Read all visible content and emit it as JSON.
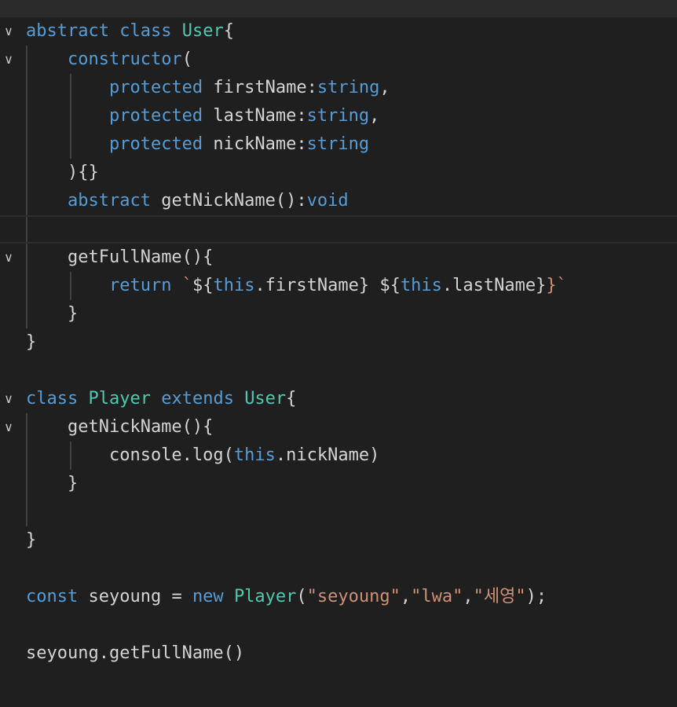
{
  "lines": [
    {
      "fold": true,
      "tokens": [
        [
          "kw",
          "abstract"
        ],
        [
          "pl",
          " "
        ],
        [
          "kw",
          "class"
        ],
        [
          "pl",
          " "
        ],
        [
          "ty",
          "User"
        ],
        [
          "pl",
          "{"
        ]
      ]
    },
    {
      "fold": true,
      "tokens": [
        [
          "pl",
          "    "
        ],
        [
          "kw",
          "constructor"
        ],
        [
          "pl",
          "("
        ]
      ]
    },
    {
      "fold": false,
      "tokens": [
        [
          "pl",
          "        "
        ],
        [
          "kw",
          "protected"
        ],
        [
          "pl",
          " firstName:"
        ],
        [
          "kw",
          "string"
        ],
        [
          "pl",
          ","
        ]
      ]
    },
    {
      "fold": false,
      "tokens": [
        [
          "pl",
          "        "
        ],
        [
          "kw",
          "protected"
        ],
        [
          "pl",
          " lastName:"
        ],
        [
          "kw",
          "string"
        ],
        [
          "pl",
          ","
        ]
      ]
    },
    {
      "fold": false,
      "tokens": [
        [
          "pl",
          "        "
        ],
        [
          "kw",
          "protected"
        ],
        [
          "pl",
          " nickName:"
        ],
        [
          "kw",
          "string"
        ]
      ]
    },
    {
      "fold": false,
      "tokens": [
        [
          "pl",
          "    "
        ],
        [
          "pl",
          "){}"
        ]
      ]
    },
    {
      "fold": false,
      "tokens": [
        [
          "pl",
          "    "
        ],
        [
          "kw",
          "abstract"
        ],
        [
          "pl",
          " getNickName():"
        ],
        [
          "kw",
          "void"
        ]
      ]
    },
    {
      "fold": false,
      "current": true,
      "tokens": []
    },
    {
      "fold": true,
      "tokens": [
        [
          "pl",
          "    "
        ],
        [
          "pl",
          "getFullName(){"
        ]
      ]
    },
    {
      "fold": false,
      "tokens": [
        [
          "pl",
          "        "
        ],
        [
          "kw",
          "return"
        ],
        [
          "pl",
          " "
        ],
        [
          "st",
          "`"
        ],
        [
          "pl",
          "${"
        ],
        [
          "kw",
          "this"
        ],
        [
          "pl",
          ".firstName} ${"
        ],
        [
          "kw",
          "this"
        ],
        [
          "pl",
          ".lastName}"
        ],
        [
          "st",
          "}`"
        ]
      ]
    },
    {
      "fold": false,
      "tokens": [
        [
          "pl",
          "    }"
        ]
      ]
    },
    {
      "fold": false,
      "tokens": [
        [
          "pl",
          "}"
        ]
      ]
    },
    {
      "fold": false,
      "tokens": []
    },
    {
      "fold": true,
      "tokens": [
        [
          "kw",
          "class"
        ],
        [
          "pl",
          " "
        ],
        [
          "ty",
          "Player"
        ],
        [
          "pl",
          " "
        ],
        [
          "kw",
          "extends"
        ],
        [
          "pl",
          " "
        ],
        [
          "ty",
          "User"
        ],
        [
          "pl",
          "{"
        ]
      ]
    },
    {
      "fold": true,
      "tokens": [
        [
          "pl",
          "    getNickName(){"
        ]
      ]
    },
    {
      "fold": false,
      "tokens": [
        [
          "pl",
          "        console.log("
        ],
        [
          "kw",
          "this"
        ],
        [
          "pl",
          ".nickName)"
        ]
      ]
    },
    {
      "fold": false,
      "tokens": [
        [
          "pl",
          "    }"
        ]
      ]
    },
    {
      "fold": false,
      "tokens": []
    },
    {
      "fold": false,
      "tokens": [
        [
          "pl",
          "}"
        ]
      ]
    },
    {
      "fold": false,
      "tokens": []
    },
    {
      "fold": false,
      "tokens": [
        [
          "kw",
          "const"
        ],
        [
          "pl",
          " seyoung = "
        ],
        [
          "kw",
          "new"
        ],
        [
          "pl",
          " "
        ],
        [
          "ty",
          "Player"
        ],
        [
          "pl",
          "("
        ],
        [
          "st",
          "\"seyoung\""
        ],
        [
          "pl",
          ","
        ],
        [
          "st",
          "\"lwa\""
        ],
        [
          "pl",
          ","
        ],
        [
          "st",
          "\"세영\""
        ],
        [
          "pl",
          ");"
        ]
      ]
    },
    {
      "fold": false,
      "tokens": []
    },
    {
      "fold": false,
      "tokens": [
        [
          "pl",
          "seyoung.getFullName()"
        ]
      ]
    }
  ],
  "icons": {
    "fold": "chevron-down-icon"
  },
  "colors": {
    "background": "#1f1f1f",
    "keyword": "#569cd6",
    "type": "#4ec9b0",
    "string": "#ce9178",
    "plain": "#d4d4d4"
  }
}
